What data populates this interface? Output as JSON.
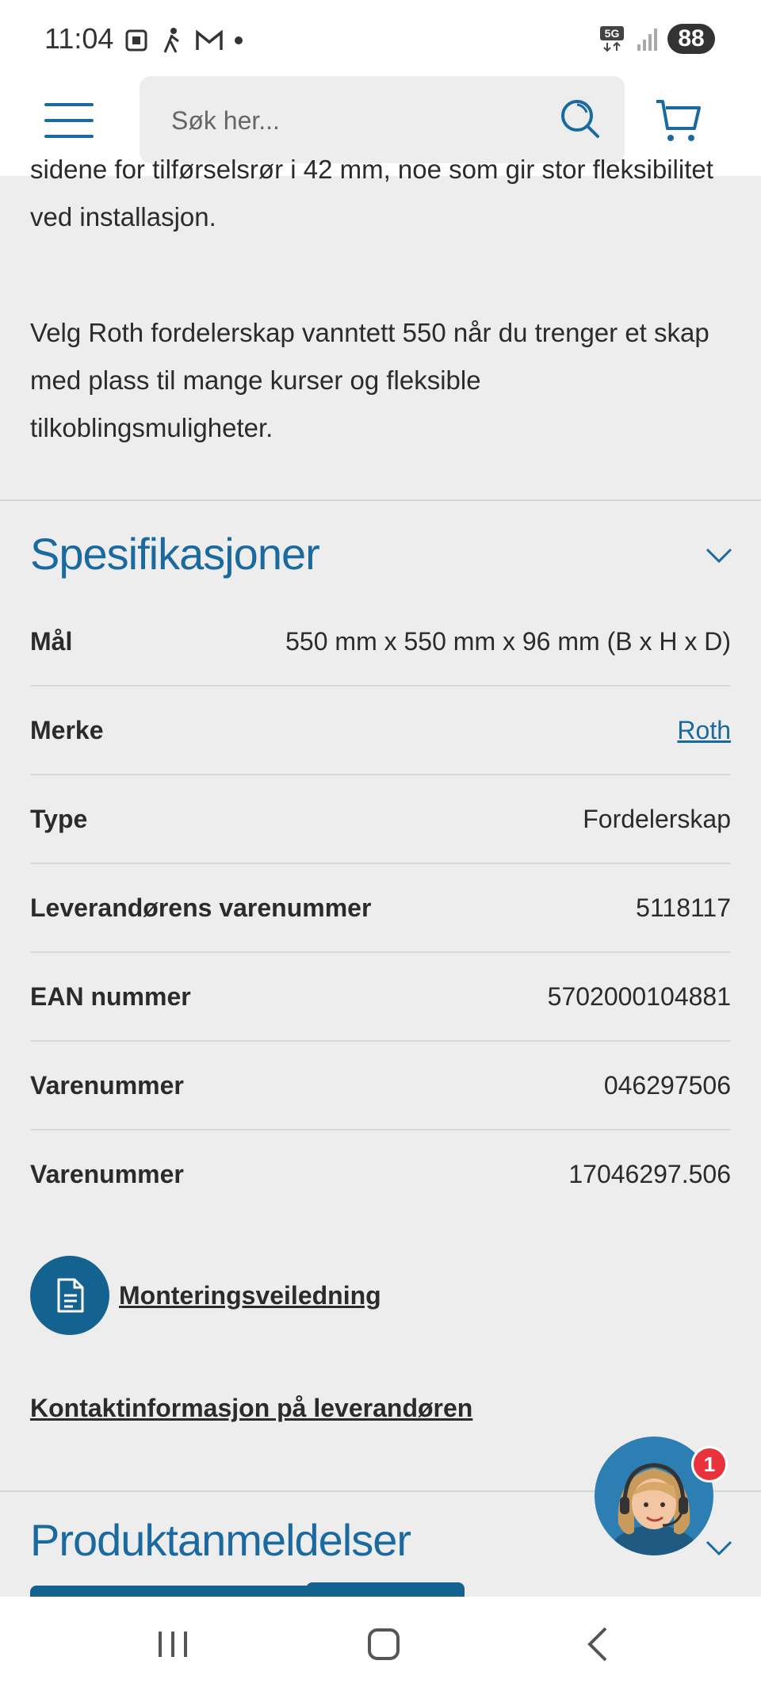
{
  "status_bar": {
    "time": "11:04",
    "network": "5G",
    "battery": "88"
  },
  "header": {
    "search_placeholder": "Søk her..."
  },
  "description": {
    "paragraph_1": "sidene for tilførselsrør i 42 mm, noe som gir stor fleksibilitet ved installasjon.",
    "paragraph_2": "Velg Roth fordelerskap vanntett 550 når du trenger et skap med plass til mange kurser og fleksible tilkoblingsmuligheter."
  },
  "specifications": {
    "title": "Spesifikasjoner",
    "rows": [
      {
        "label": "Mål",
        "value": "550 mm x 550 mm x 96 mm (B x H x D)"
      },
      {
        "label": "Merke",
        "value": "Roth"
      },
      {
        "label": "Type",
        "value": "Fordelerskap"
      },
      {
        "label": "Leverandørens varenummer",
        "value": "5118117"
      },
      {
        "label": "EAN nummer",
        "value": "5702000104881"
      },
      {
        "label": "Varenummer",
        "value": "046297506"
      },
      {
        "label": "Varenummer",
        "value": "17046297.506"
      }
    ],
    "doc_link": "Monteringsveiledning",
    "contact_link": "Kontaktinformasjon på leverandøren"
  },
  "reviews": {
    "title": "Produktanmeldelser"
  },
  "chat": {
    "badge_count": "1"
  },
  "colors": {
    "accent": "#1a6aa0",
    "badge": "#e8323c"
  }
}
